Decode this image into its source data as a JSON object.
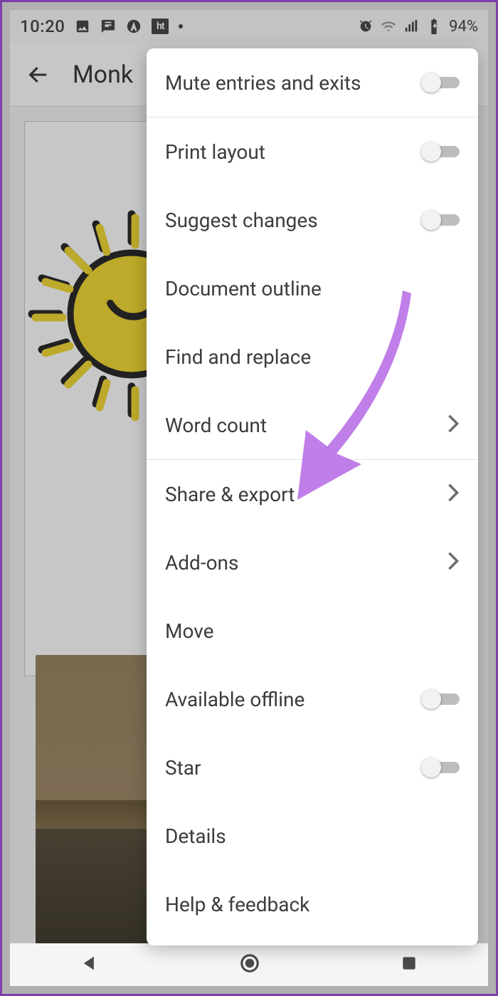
{
  "statusbar": {
    "time": "10:20",
    "battery": "94%",
    "ht_label": "ht"
  },
  "header": {
    "title": "Monk"
  },
  "menu": {
    "mute": "Mute entries and exits",
    "print_layout": "Print layout",
    "suggest_changes": "Suggest changes",
    "document_outline": "Document outline",
    "find_replace": "Find and replace",
    "word_count": "Word count",
    "share_export": "Share & export",
    "addons": "Add-ons",
    "move": "Move",
    "offline": "Available offline",
    "star": "Star",
    "details": "Details",
    "help": "Help & feedback"
  }
}
